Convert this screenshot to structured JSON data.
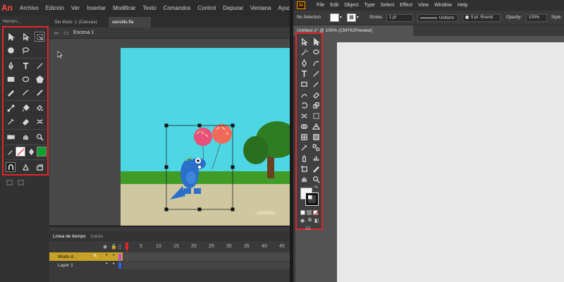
{
  "animate": {
    "logo": "An",
    "menu": [
      "Archivo",
      "Edición",
      "Ver",
      "Insertar",
      "Modificar",
      "Texto",
      "Comandos",
      "Control",
      "Depurar",
      "Ventana",
      "Ayuda"
    ],
    "tool_panel_title": "Herram...",
    "doc_tabs": [
      "Sin título: 1 (Canvas)",
      "sencillo.fla"
    ],
    "scene_label": "Escena 1",
    "timeline": {
      "tabs": [
        "Línea de tiempo",
        "Salida"
      ],
      "frame_numbers": [
        "1",
        "5",
        "10",
        "15",
        "20",
        "25",
        "30",
        "35",
        "40",
        "45"
      ],
      "layers": [
        {
          "name": "Modo d…",
          "active": true
        },
        {
          "name": "Layer 1",
          "active": false
        }
      ]
    }
  },
  "illustrator": {
    "logo": "Ai",
    "menu": [
      "File",
      "Edit",
      "Object",
      "Type",
      "Select",
      "Effect",
      "View",
      "Window",
      "Help"
    ],
    "control": {
      "selection": "No Selection",
      "stroke_label": "Stroke:",
      "stroke_value": "1 pt",
      "profile": "Uniform",
      "brush": "5 pt. Round",
      "opacity_label": "Opacity:",
      "opacity_value": "100%",
      "style_label": "Style:"
    },
    "doc_tab": "Untitled-1* @ 100% (CMYK/Preview)",
    "more_tools": "…"
  },
  "colors": {
    "highlight_border": "#e0262b",
    "stage_sky": "#4dd6e3",
    "grass": "#3f9c27",
    "ground": "#cfc7a0",
    "monster": "#2a6fc9",
    "balloon_left": "#e6507a",
    "balloon_right": "#f06a5c",
    "an_accent": "#ff4a3c",
    "ai_accent": "#ff9a00"
  }
}
